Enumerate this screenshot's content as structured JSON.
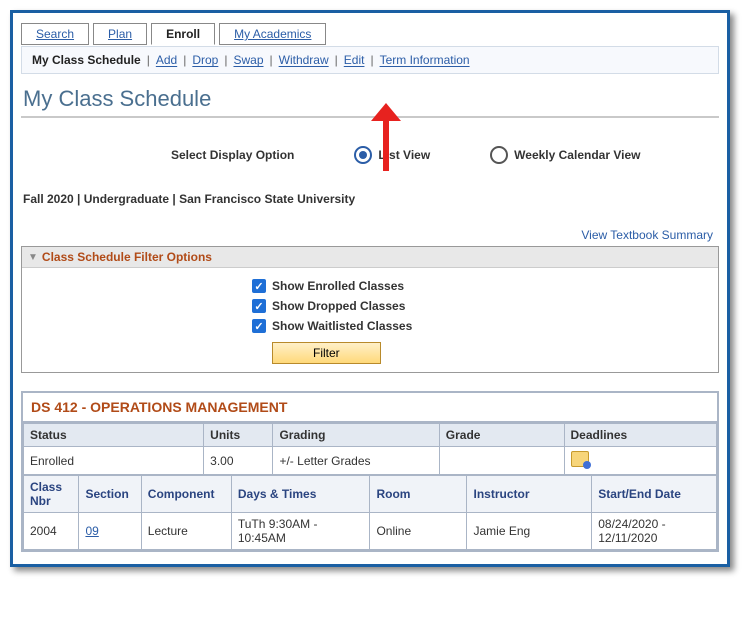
{
  "tabs": {
    "search": "Search",
    "plan": "Plan",
    "enroll": "Enroll",
    "academics": "My Academics"
  },
  "subnav": {
    "current": "My Class Schedule",
    "add": "Add",
    "drop": "Drop",
    "swap": "Swap",
    "withdraw": "Withdraw",
    "edit": "Edit",
    "term_info": "Term Information"
  },
  "page_title": "My Class Schedule",
  "display": {
    "label": "Select Display Option",
    "list": "List View",
    "calendar": "Weekly Calendar View"
  },
  "term_line": "Fall 2020 | Undergraduate | San Francisco State University",
  "textbook_link": "View Textbook Summary",
  "filter": {
    "panel_title": "Class Schedule Filter Options",
    "enrolled": "Show Enrolled Classes",
    "dropped": "Show Dropped Classes",
    "waitlisted": "Show Waitlisted Classes",
    "button": "Filter"
  },
  "class": {
    "title": "DS 412 - OPERATIONS MANAGEMENT",
    "cols1": {
      "status": "Status",
      "units": "Units",
      "grading": "Grading",
      "grade": "Grade",
      "deadlines": "Deadlines"
    },
    "row1": {
      "status": "Enrolled",
      "units": "3.00",
      "grading": "+/- Letter Grades",
      "grade": ""
    },
    "cols2": {
      "nbr": "Class Nbr",
      "section": "Section",
      "component": "Component",
      "days": "Days & Times",
      "room": "Room",
      "instructor": "Instructor",
      "dates": "Start/End Date"
    },
    "row2": {
      "nbr": "2004",
      "section": "09",
      "component": "Lecture",
      "days": "TuTh 9:30AM - 10:45AM",
      "room": "Online",
      "instructor": "Jamie Eng",
      "dates": "08/24/2020 - 12/11/2020"
    }
  }
}
